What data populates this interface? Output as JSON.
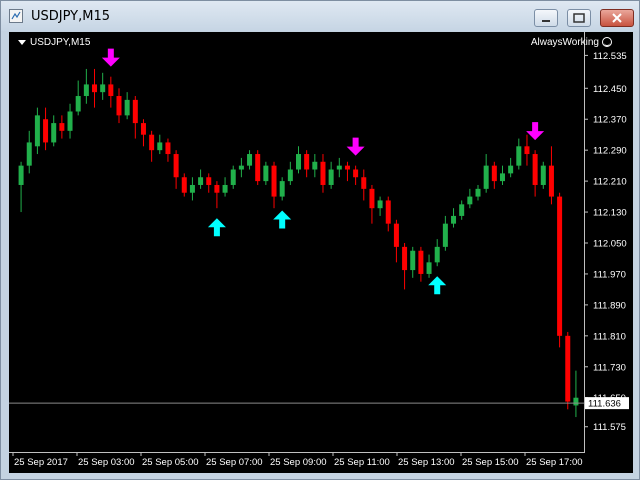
{
  "window": {
    "title": "USDJPY,M15"
  },
  "chart": {
    "symbol_label": "USDJPY,M15",
    "indicator_label": "AlwaysWorking",
    "current_price": "111.636",
    "colors": {
      "bull": "#21b04b",
      "bear": "#ff0000",
      "up_arrow": "#00ffff",
      "down_arrow": "#ff00ff",
      "background": "#000000"
    }
  },
  "chart_data": {
    "type": "candlestick",
    "ylim": [
      111.52,
      112.58
    ],
    "y_ticks": [
      "112.535",
      "112.450",
      "112.370",
      "112.290",
      "112.210",
      "112.130",
      "112.050",
      "111.970",
      "111.890",
      "111.810",
      "111.730",
      "111.650",
      "111.575"
    ],
    "x_labels": [
      "25 Sep 2017",
      "25 Sep 03:00",
      "25 Sep 05:00",
      "25 Sep 07:00",
      "25 Sep 09:00",
      "25 Sep 11:00",
      "25 Sep 13:00",
      "25 Sep 15:00",
      "25 Sep 17:00"
    ],
    "price_line": 111.636,
    "candles": [
      [
        112.2,
        112.25,
        112.13,
        112.26
      ],
      [
        112.25,
        112.31,
        112.23,
        112.34
      ],
      [
        112.3,
        112.38,
        112.28,
        112.4
      ],
      [
        112.37,
        112.31,
        112.29,
        112.4
      ],
      [
        112.31,
        112.36,
        112.3,
        112.38
      ],
      [
        112.36,
        112.34,
        112.32,
        112.38
      ],
      [
        112.34,
        112.39,
        112.32,
        112.41
      ],
      [
        112.39,
        112.43,
        112.38,
        112.47
      ],
      [
        112.43,
        112.46,
        112.41,
        112.5
      ],
      [
        112.46,
        112.44,
        112.4,
        112.5
      ],
      [
        112.44,
        112.46,
        112.42,
        112.49
      ],
      [
        112.46,
        112.43,
        112.4,
        112.48
      ],
      [
        112.43,
        112.38,
        112.36,
        112.45
      ],
      [
        112.38,
        112.42,
        112.37,
        112.44
      ],
      [
        112.42,
        112.36,
        112.32,
        112.43
      ],
      [
        112.36,
        112.33,
        112.3,
        112.37
      ],
      [
        112.33,
        112.29,
        112.26,
        112.34
      ],
      [
        112.29,
        112.31,
        112.28,
        112.33
      ],
      [
        112.31,
        112.28,
        112.26,
        112.32
      ],
      [
        112.28,
        112.22,
        112.19,
        112.29
      ],
      [
        112.22,
        112.18,
        112.17,
        112.23
      ],
      [
        112.18,
        112.2,
        112.16,
        112.22
      ],
      [
        112.2,
        112.22,
        112.19,
        112.24
      ],
      [
        112.22,
        112.2,
        112.18,
        112.23
      ],
      [
        112.2,
        112.18,
        112.14,
        112.21
      ],
      [
        112.18,
        112.2,
        112.17,
        112.22
      ],
      [
        112.2,
        112.24,
        112.19,
        112.25
      ],
      [
        112.24,
        112.25,
        112.22,
        112.27
      ],
      [
        112.25,
        112.28,
        112.24,
        112.29
      ],
      [
        112.28,
        112.21,
        112.2,
        112.29
      ],
      [
        112.21,
        112.25,
        112.2,
        112.26
      ],
      [
        112.25,
        112.17,
        112.14,
        112.26
      ],
      [
        112.17,
        112.21,
        112.16,
        112.22
      ],
      [
        112.21,
        112.24,
        112.2,
        112.26
      ],
      [
        112.24,
        112.28,
        112.23,
        112.3
      ],
      [
        112.28,
        112.24,
        112.22,
        112.29
      ],
      [
        112.24,
        112.26,
        112.22,
        112.28
      ],
      [
        112.26,
        112.2,
        112.18,
        112.28
      ],
      [
        112.2,
        112.24,
        112.19,
        112.26
      ],
      [
        112.24,
        112.25,
        112.22,
        112.27
      ],
      [
        112.25,
        112.24,
        112.21,
        112.26
      ],
      [
        112.24,
        112.22,
        112.2,
        112.25
      ],
      [
        112.22,
        112.19,
        112.16,
        112.24
      ],
      [
        112.19,
        112.14,
        112.1,
        112.2
      ],
      [
        112.14,
        112.16,
        112.12,
        112.17
      ],
      [
        112.16,
        112.1,
        112.08,
        112.17
      ],
      [
        112.1,
        112.04,
        112.0,
        112.11
      ],
      [
        112.04,
        111.98,
        111.93,
        112.05
      ],
      [
        111.98,
        112.03,
        111.96,
        112.04
      ],
      [
        112.03,
        111.97,
        111.95,
        112.04
      ],
      [
        111.97,
        112.0,
        111.96,
        112.02
      ],
      [
        112.0,
        112.04,
        111.99,
        112.06
      ],
      [
        112.04,
        112.1,
        112.03,
        112.12
      ],
      [
        112.1,
        112.12,
        112.09,
        112.14
      ],
      [
        112.12,
        112.15,
        112.11,
        112.16
      ],
      [
        112.15,
        112.17,
        112.14,
        112.19
      ],
      [
        112.17,
        112.19,
        112.16,
        112.2
      ],
      [
        112.19,
        112.25,
        112.18,
        112.28
      ],
      [
        112.25,
        112.21,
        112.19,
        112.26
      ],
      [
        112.21,
        112.23,
        112.2,
        112.25
      ],
      [
        112.23,
        112.25,
        112.22,
        112.27
      ],
      [
        112.25,
        112.3,
        112.24,
        112.32
      ],
      [
        112.3,
        112.28,
        112.25,
        112.33
      ],
      [
        112.28,
        112.2,
        112.17,
        112.29
      ],
      [
        112.2,
        112.25,
        112.19,
        112.26
      ],
      [
        112.25,
        112.17,
        112.15,
        112.3
      ],
      [
        112.17,
        111.81,
        111.78,
        112.18
      ],
      [
        111.81,
        111.64,
        111.62,
        111.82
      ],
      [
        111.63,
        111.65,
        111.6,
        111.72
      ]
    ],
    "up_arrows": [
      24,
      32,
      51
    ],
    "down_arrows": [
      11,
      41,
      63
    ]
  }
}
